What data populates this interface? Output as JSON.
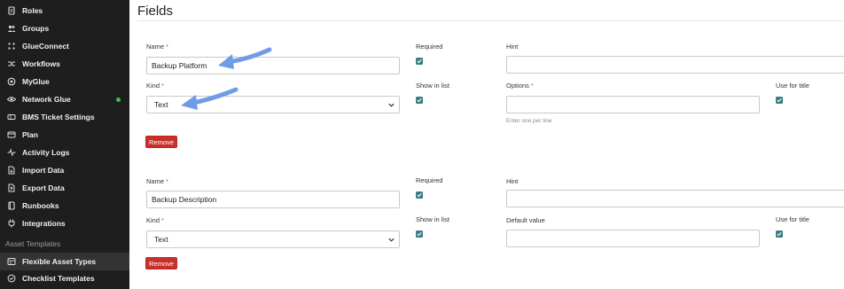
{
  "sidebar": {
    "items": [
      {
        "label": "Roles",
        "icon": "document-icon"
      },
      {
        "label": "Groups",
        "icon": "people-icon"
      },
      {
        "label": "GlueConnect",
        "icon": "connect-icon"
      },
      {
        "label": "Workflows",
        "icon": "shuffle-icon"
      },
      {
        "label": "MyGlue",
        "icon": "glue-icon"
      },
      {
        "label": "Network Glue",
        "icon": "eye-icon",
        "status": "online"
      },
      {
        "label": "BMS Ticket Settings",
        "icon": "ticket-icon"
      },
      {
        "label": "Plan",
        "icon": "card-icon"
      },
      {
        "label": "Activity Logs",
        "icon": "activity-icon"
      },
      {
        "label": "Import Data",
        "icon": "import-icon"
      },
      {
        "label": "Export Data",
        "icon": "export-icon"
      },
      {
        "label": "Runbooks",
        "icon": "book-icon"
      },
      {
        "label": "Integrations",
        "icon": "plug-icon"
      }
    ],
    "section_header": "Asset Templates",
    "section_items": [
      {
        "label": "Flexible Asset Types",
        "icon": "grid-icon",
        "active": true
      },
      {
        "label": "Checklist Templates",
        "icon": "check-circle-icon"
      }
    ]
  },
  "page": {
    "title": "Fields"
  },
  "fields": [
    {
      "name_label": "Name",
      "name_value": "Backup Platform",
      "kind_label": "Kind",
      "kind_value": "Text",
      "required_label": "Required",
      "required_checked": true,
      "show_in_list_label": "Show in list",
      "show_in_list_checked": true,
      "hint_label": "Hint",
      "hint_value": "",
      "options_label": "Options",
      "options_value": "",
      "options_help": "Enter one per line",
      "use_for_title_label": "Use for title",
      "use_for_title_checked": true,
      "remove_label": "Remove"
    },
    {
      "name_label": "Name",
      "name_value": "Backup Description",
      "kind_label": "Kind",
      "kind_value": "Text",
      "required_label": "Required",
      "required_checked": true,
      "show_in_list_label": "Show in list",
      "show_in_list_checked": true,
      "hint_label": "Hint",
      "hint_value": "",
      "default_value_label": "Default value",
      "default_value": "",
      "use_for_title_label": "Use for title",
      "use_for_title_checked": true,
      "remove_label": "Remove"
    }
  ],
  "required_marker": "*",
  "colors": {
    "sidebar_bg": "#1e1e1e",
    "checkbox": "#3a7d86",
    "remove_button": "#c9302c",
    "annotation_arrow": "#6f9ce8",
    "status_online": "#3fb950"
  }
}
